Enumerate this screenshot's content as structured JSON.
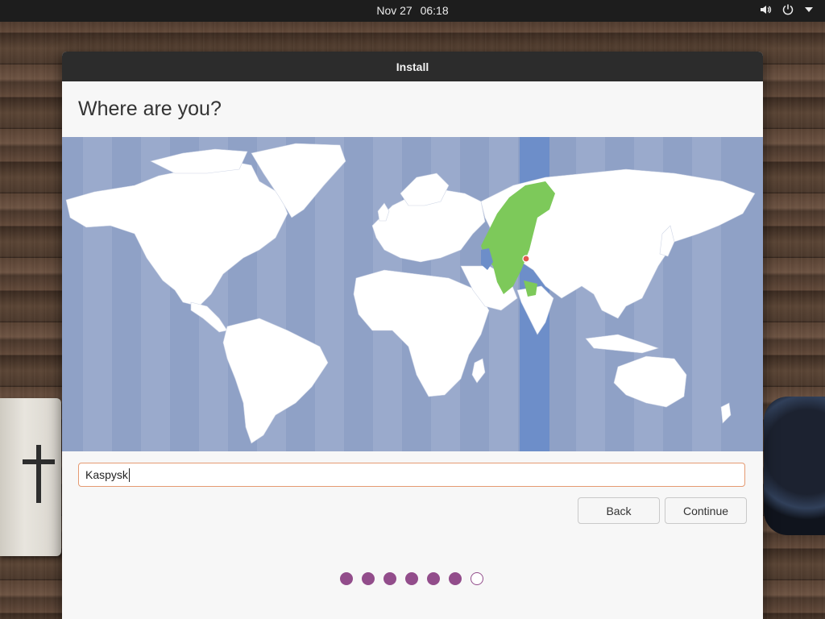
{
  "topbar": {
    "date": "Nov 27",
    "time": "06:18",
    "icons": [
      "volume-icon",
      "power-icon",
      "menu-arrow-icon"
    ]
  },
  "window": {
    "title": "Install",
    "heading": "Where are you?"
  },
  "map": {
    "selected_region": "Kaspysk",
    "selected_color": "#7dc95a",
    "ocean_color": "#8fa1c6",
    "highlight_band_color": "#6d8ec9"
  },
  "search": {
    "value": "Kaspysk"
  },
  "buttons": {
    "back": "Back",
    "continue": "Continue"
  },
  "progress": {
    "completed_steps": 6,
    "total_steps": 7,
    "accent": "#924d8b"
  }
}
